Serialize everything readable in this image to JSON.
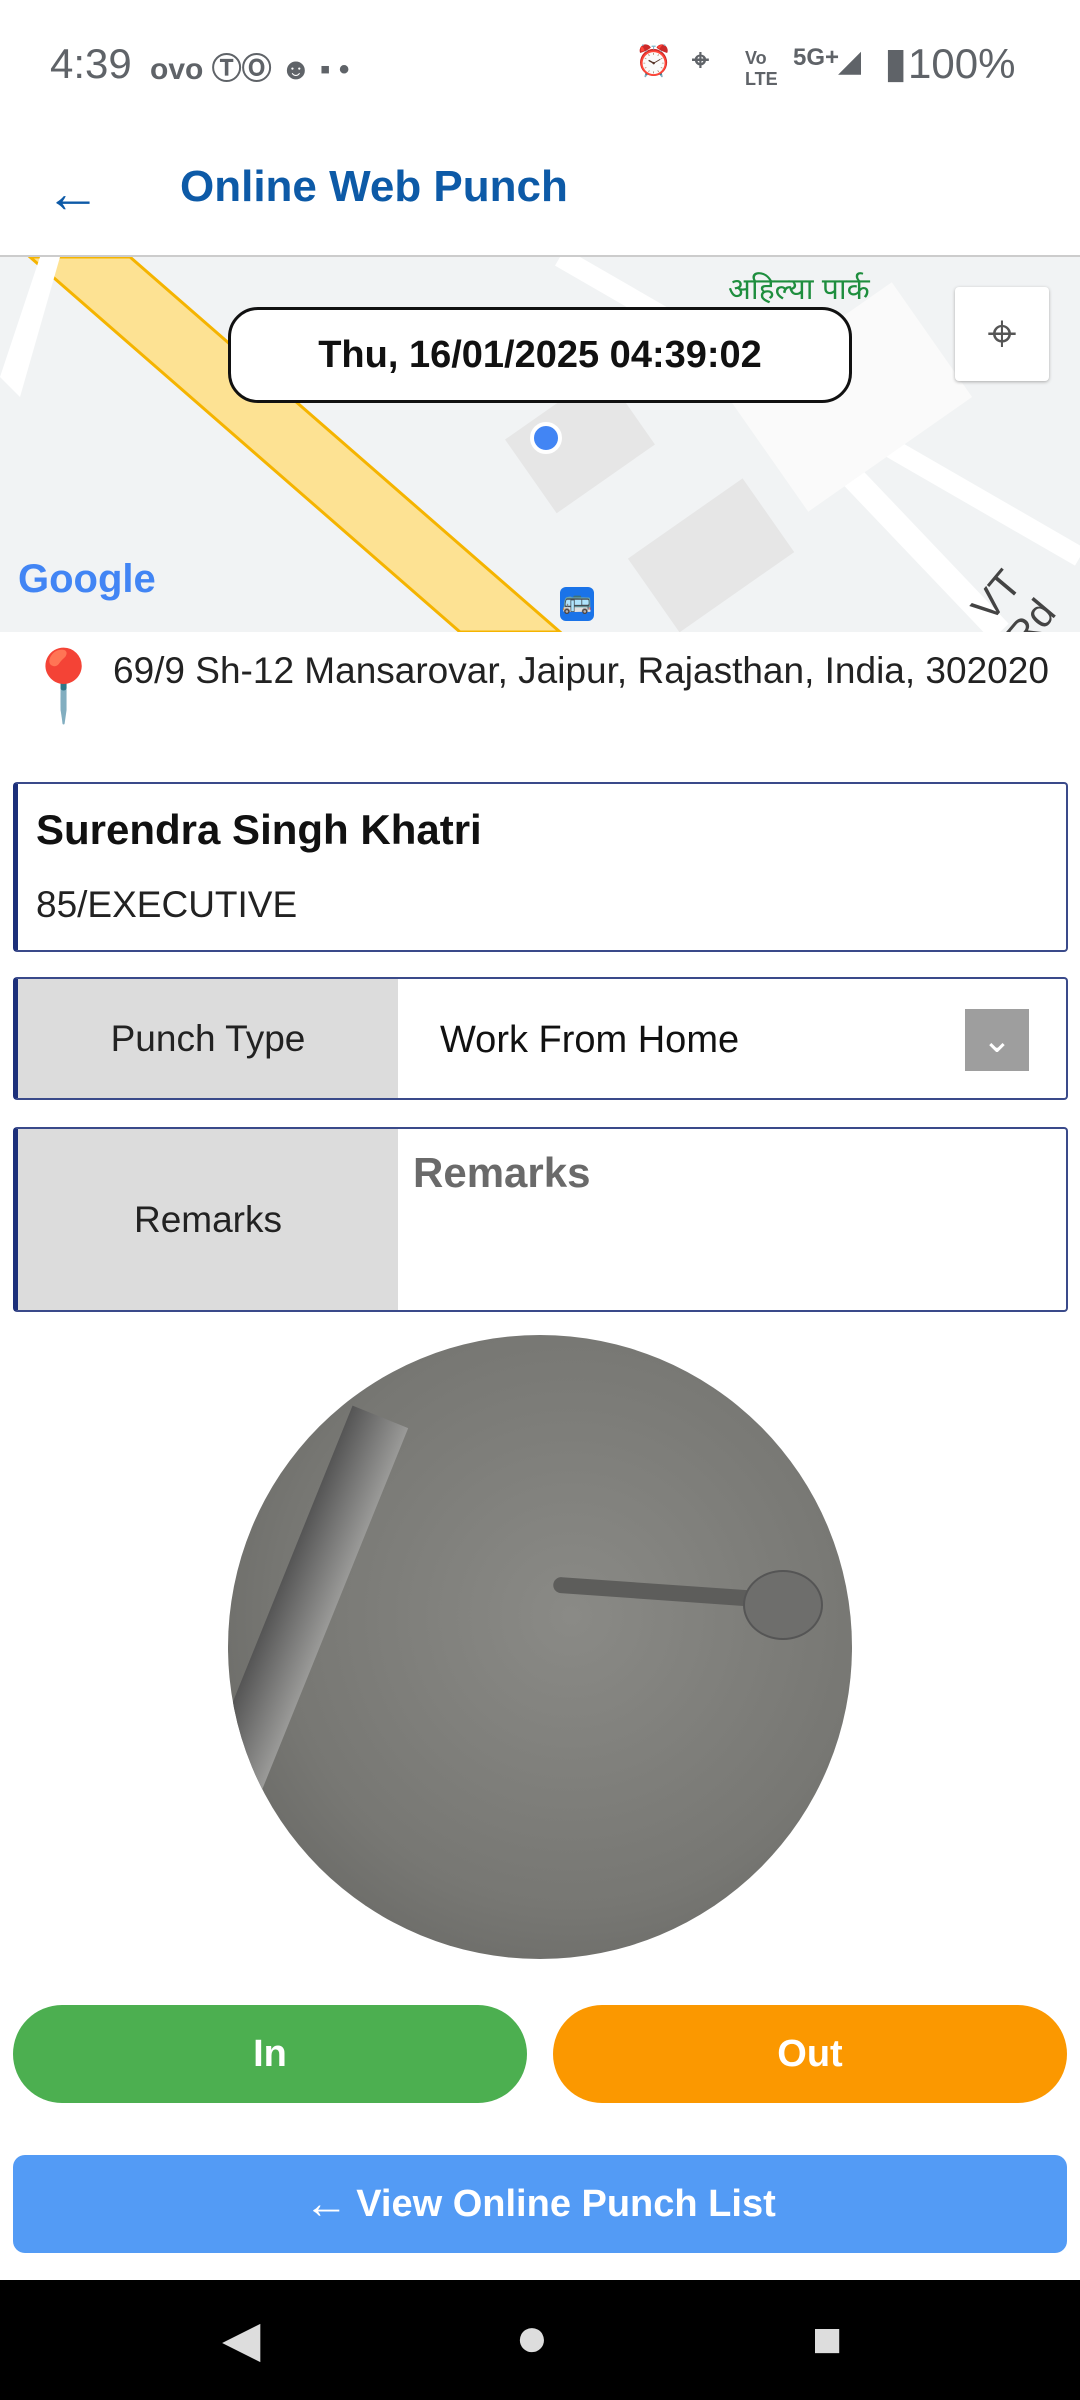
{
  "status_bar": {
    "time": "4:39",
    "notif_icons": [
      "ovo-icon",
      "teams-icon",
      "app-icon",
      "zomato-icon",
      "dot-icon"
    ],
    "network": "5G+",
    "volte": "Vo LTE",
    "battery": "100%"
  },
  "header": {
    "title": "Online Web Punch"
  },
  "map": {
    "datetime": "Thu, 16/01/2025 04:39:02",
    "place_label": "अहिल्या पार्क",
    "road_label": "VT Rd",
    "logo": "Google"
  },
  "address": "69/9 Sh-12 Mansarovar, Jaipur, Rajasthan, India, 302020",
  "employee": {
    "name": "Surendra Singh Khatri",
    "code": "85/EXECUTIVE"
  },
  "punch_type": {
    "label": "Punch Type",
    "value": "Work From Home"
  },
  "remarks": {
    "label": "Remarks",
    "placeholder": "Remarks",
    "value": ""
  },
  "buttons": {
    "in": "In",
    "out": "Out",
    "view_list": "View Online Punch List"
  },
  "colors": {
    "primary": "#0d5aa7",
    "in": "#4caf50",
    "out": "#fb9800",
    "list": "#539bf5"
  }
}
